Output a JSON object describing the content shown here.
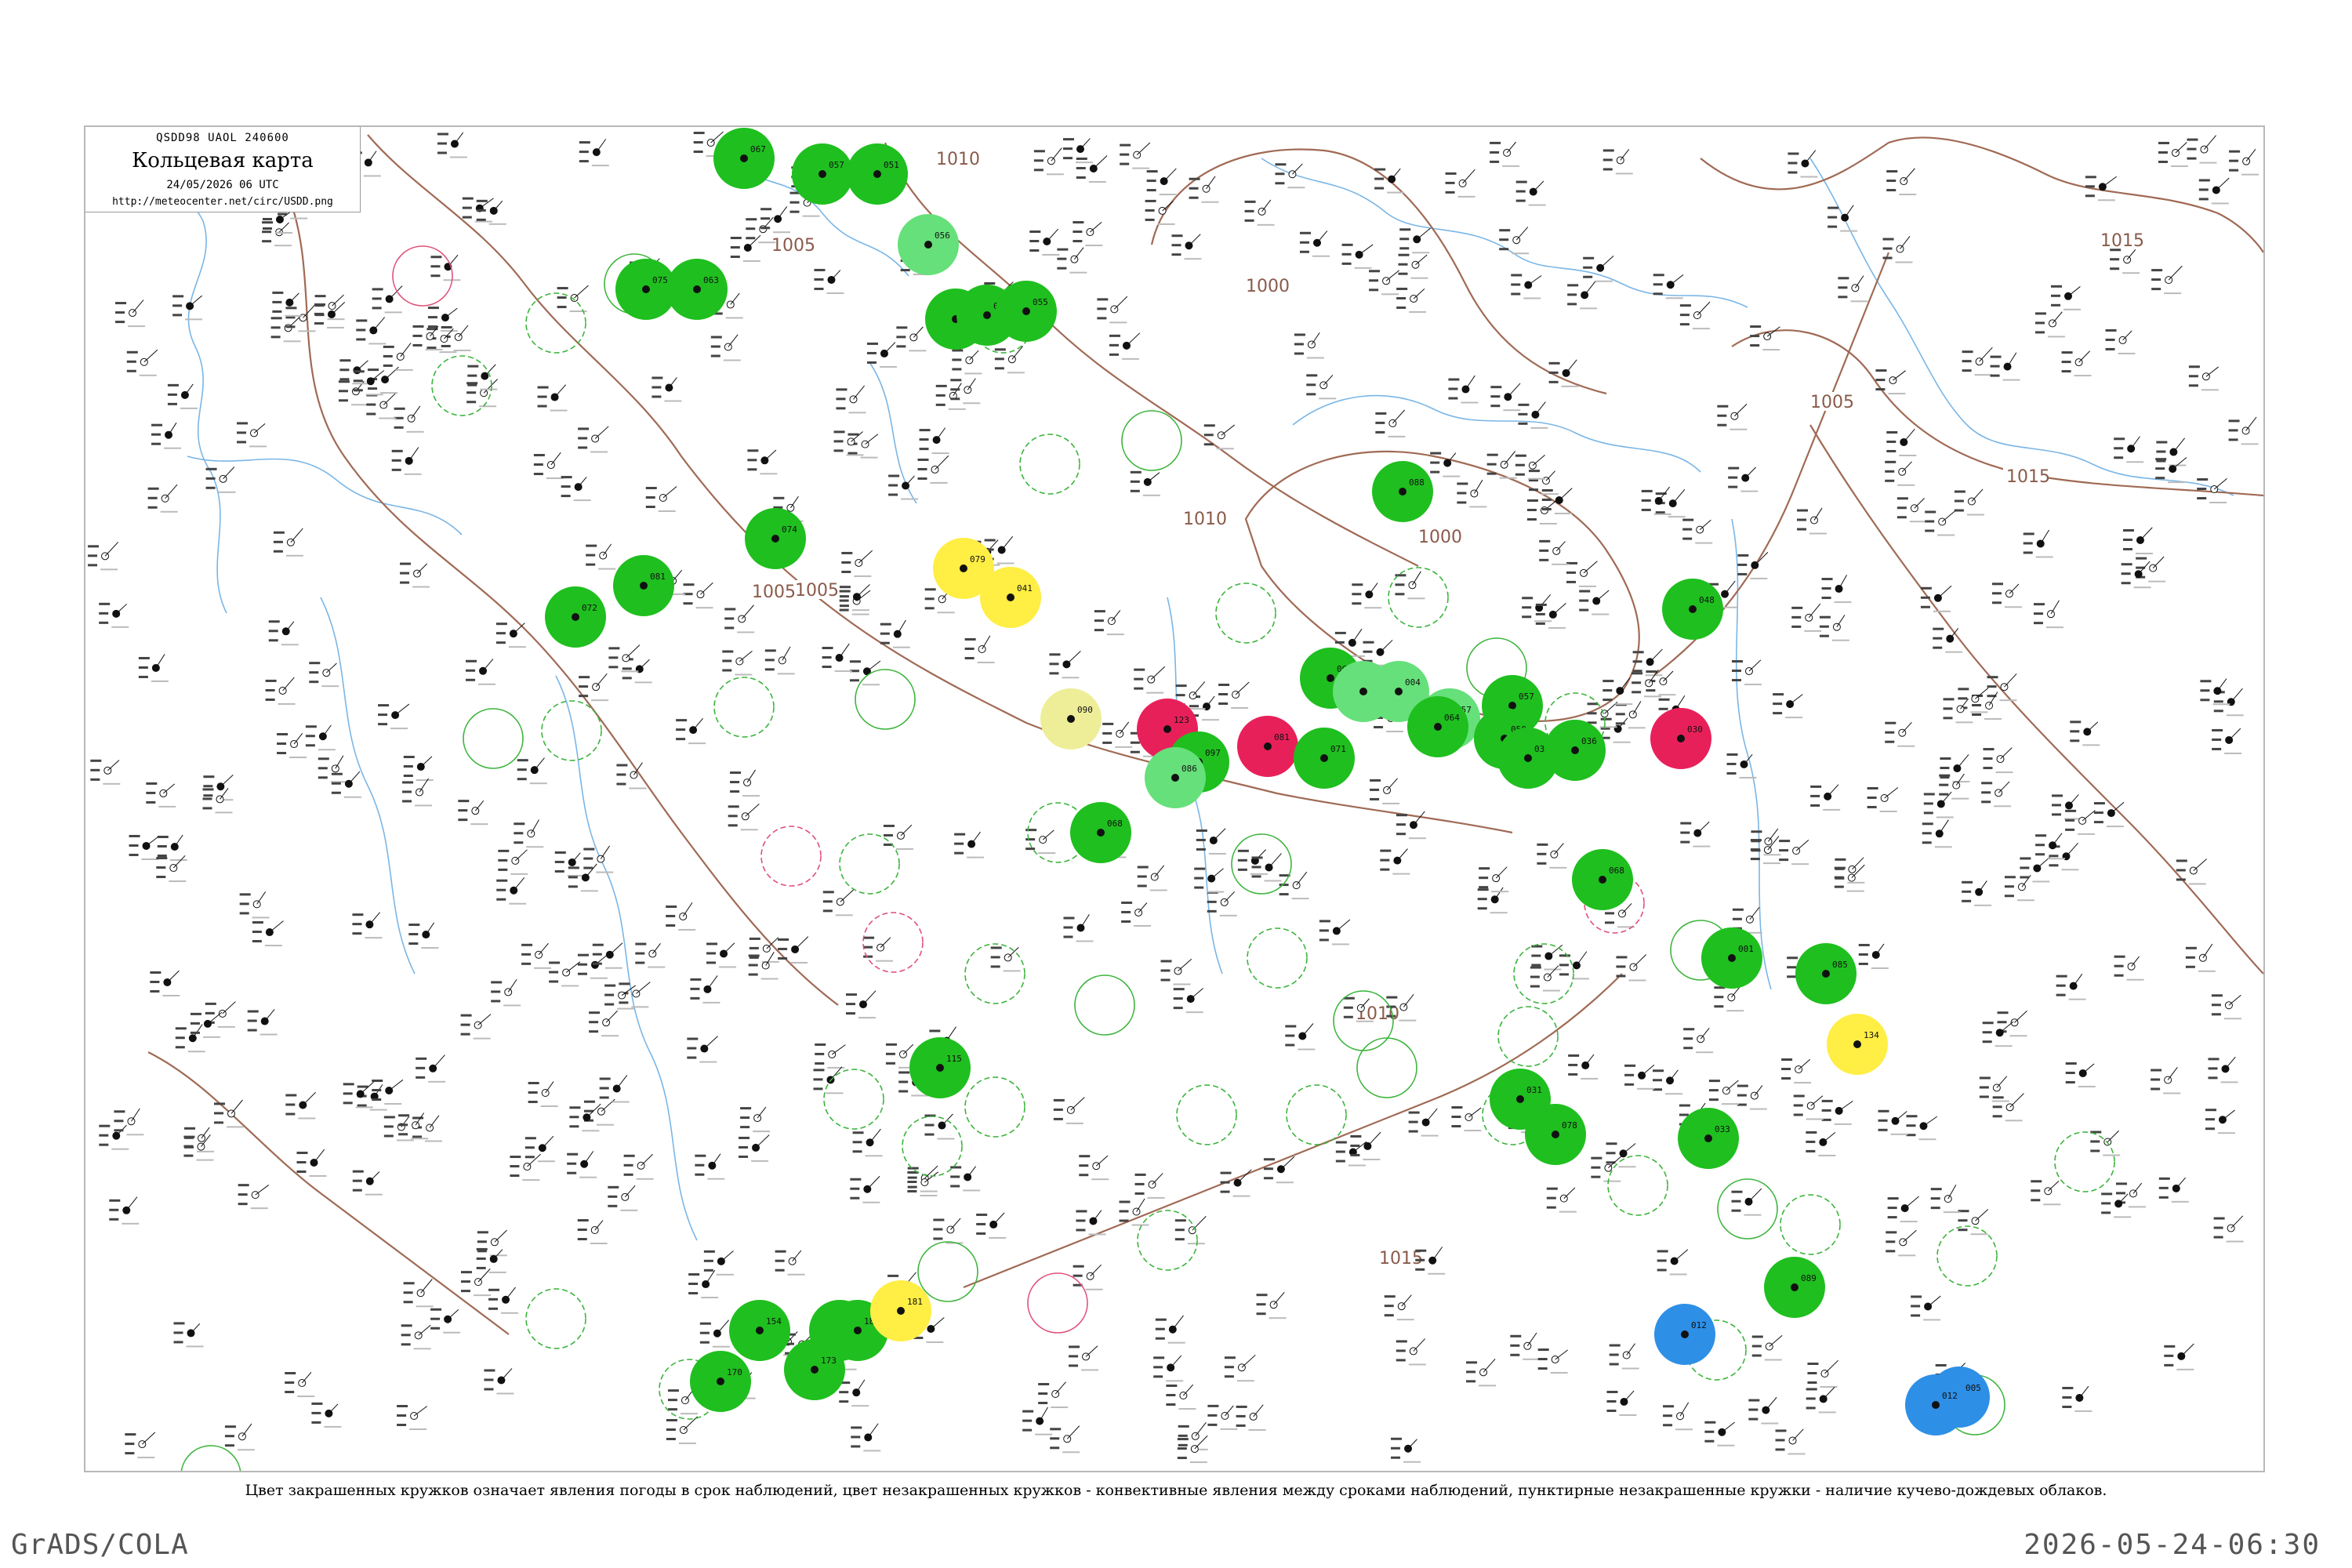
{
  "header": {
    "code": "QSDD98  UAOL  240600",
    "title": "Кольцевая карта",
    "date": "24/05/2026 06 UTC",
    "url": "http://meteocenter.net/circ/USDD.png"
  },
  "isobars": [
    "1010",
    "1005",
    "1000",
    "1005",
    "1010",
    "1005",
    "1000",
    "1005",
    "1015",
    "1010",
    "1015",
    "1015"
  ],
  "stations_filled": [
    {
      "color": "#1fbf1f",
      "code": "067"
    },
    {
      "color": "#1fbf1f",
      "code": "057"
    },
    {
      "color": "#1fbf1f",
      "code": "051"
    },
    {
      "color": "#66e07a",
      "code": "056"
    },
    {
      "color": "#1fbf1f",
      "code": "075"
    },
    {
      "color": "#1fbf1f",
      "code": "063"
    },
    {
      "color": "#1fbf1f",
      "code": "061"
    },
    {
      "color": "#1fbf1f",
      "code": "060"
    },
    {
      "color": "#1fbf1f",
      "code": "055"
    },
    {
      "color": "#1fbf1f",
      "code": "074"
    },
    {
      "color": "#1fbf1f",
      "code": "081"
    },
    {
      "color": "#1fbf1f",
      "code": "072"
    },
    {
      "color": "#1fbf1f",
      "code": "088"
    },
    {
      "color": "#ffee44",
      "code": "079"
    },
    {
      "color": "#ffee44",
      "code": "041"
    },
    {
      "color": "#eeee99",
      "code": "090"
    },
    {
      "color": "#e8205a",
      "code": "123"
    },
    {
      "color": "#1fbf1f",
      "code": "097"
    },
    {
      "color": "#66e07a",
      "code": "086"
    },
    {
      "color": "#1fbf1f",
      "code": "068"
    },
    {
      "color": "#e8205a",
      "code": "081"
    },
    {
      "color": "#1fbf1f",
      "code": "063"
    },
    {
      "color": "#1fbf1f",
      "code": "071"
    },
    {
      "color": "#66e07a",
      "code": "057"
    },
    {
      "color": "#1fbf1f",
      "code": "057"
    },
    {
      "color": "#66e07a",
      "code": "022"
    },
    {
      "color": "#66e07a",
      "code": "004"
    },
    {
      "color": "#1fbf1f",
      "code": "050"
    },
    {
      "color": "#1fbf1f",
      "code": "064"
    },
    {
      "color": "#1fbf1f",
      "code": "038"
    },
    {
      "color": "#1fbf1f",
      "code": "036"
    },
    {
      "color": "#1fbf1f",
      "code": "068"
    },
    {
      "color": "#e8205a",
      "code": "030"
    },
    {
      "color": "#1fbf1f",
      "code": "048"
    },
    {
      "color": "#1fbf1f",
      "code": "001"
    },
    {
      "color": "#1fbf1f",
      "code": "031"
    },
    {
      "color": "#1fbf1f",
      "code": "078"
    },
    {
      "color": "#1fbf1f",
      "code": "033"
    },
    {
      "color": "#1fbf1f",
      "code": "085"
    },
    {
      "color": "#ffee44",
      "code": "134"
    },
    {
      "color": "#2e8fe6",
      "code": "005"
    },
    {
      "color": "#2e8fe6",
      "code": "012"
    },
    {
      "color": "#2e8fe6",
      "code": "012"
    },
    {
      "color": "#1fbf1f",
      "code": "089"
    },
    {
      "color": "#1fbf1f",
      "code": "115"
    },
    {
      "color": "#1fbf1f",
      "code": "154"
    },
    {
      "color": "#1fbf1f",
      "code": "165"
    },
    {
      "color": "#1fbf1f",
      "code": "187"
    },
    {
      "color": "#ffee44",
      "code": "181"
    },
    {
      "color": "#1fbf1f",
      "code": "173"
    },
    {
      "color": "#1fbf1f",
      "code": "170"
    }
  ],
  "caption": "Цвет закрашенных кружков означает явления погоды в срок наблюдений, цвет незакрашенных кружков - конвективные явления между сроками наблюдений, пунктирные незакрашенные кружки - наличие кучево-дождевых облаков.",
  "footer": {
    "left": "GrADS/COLA",
    "right": "2026-05-24-06:30"
  }
}
